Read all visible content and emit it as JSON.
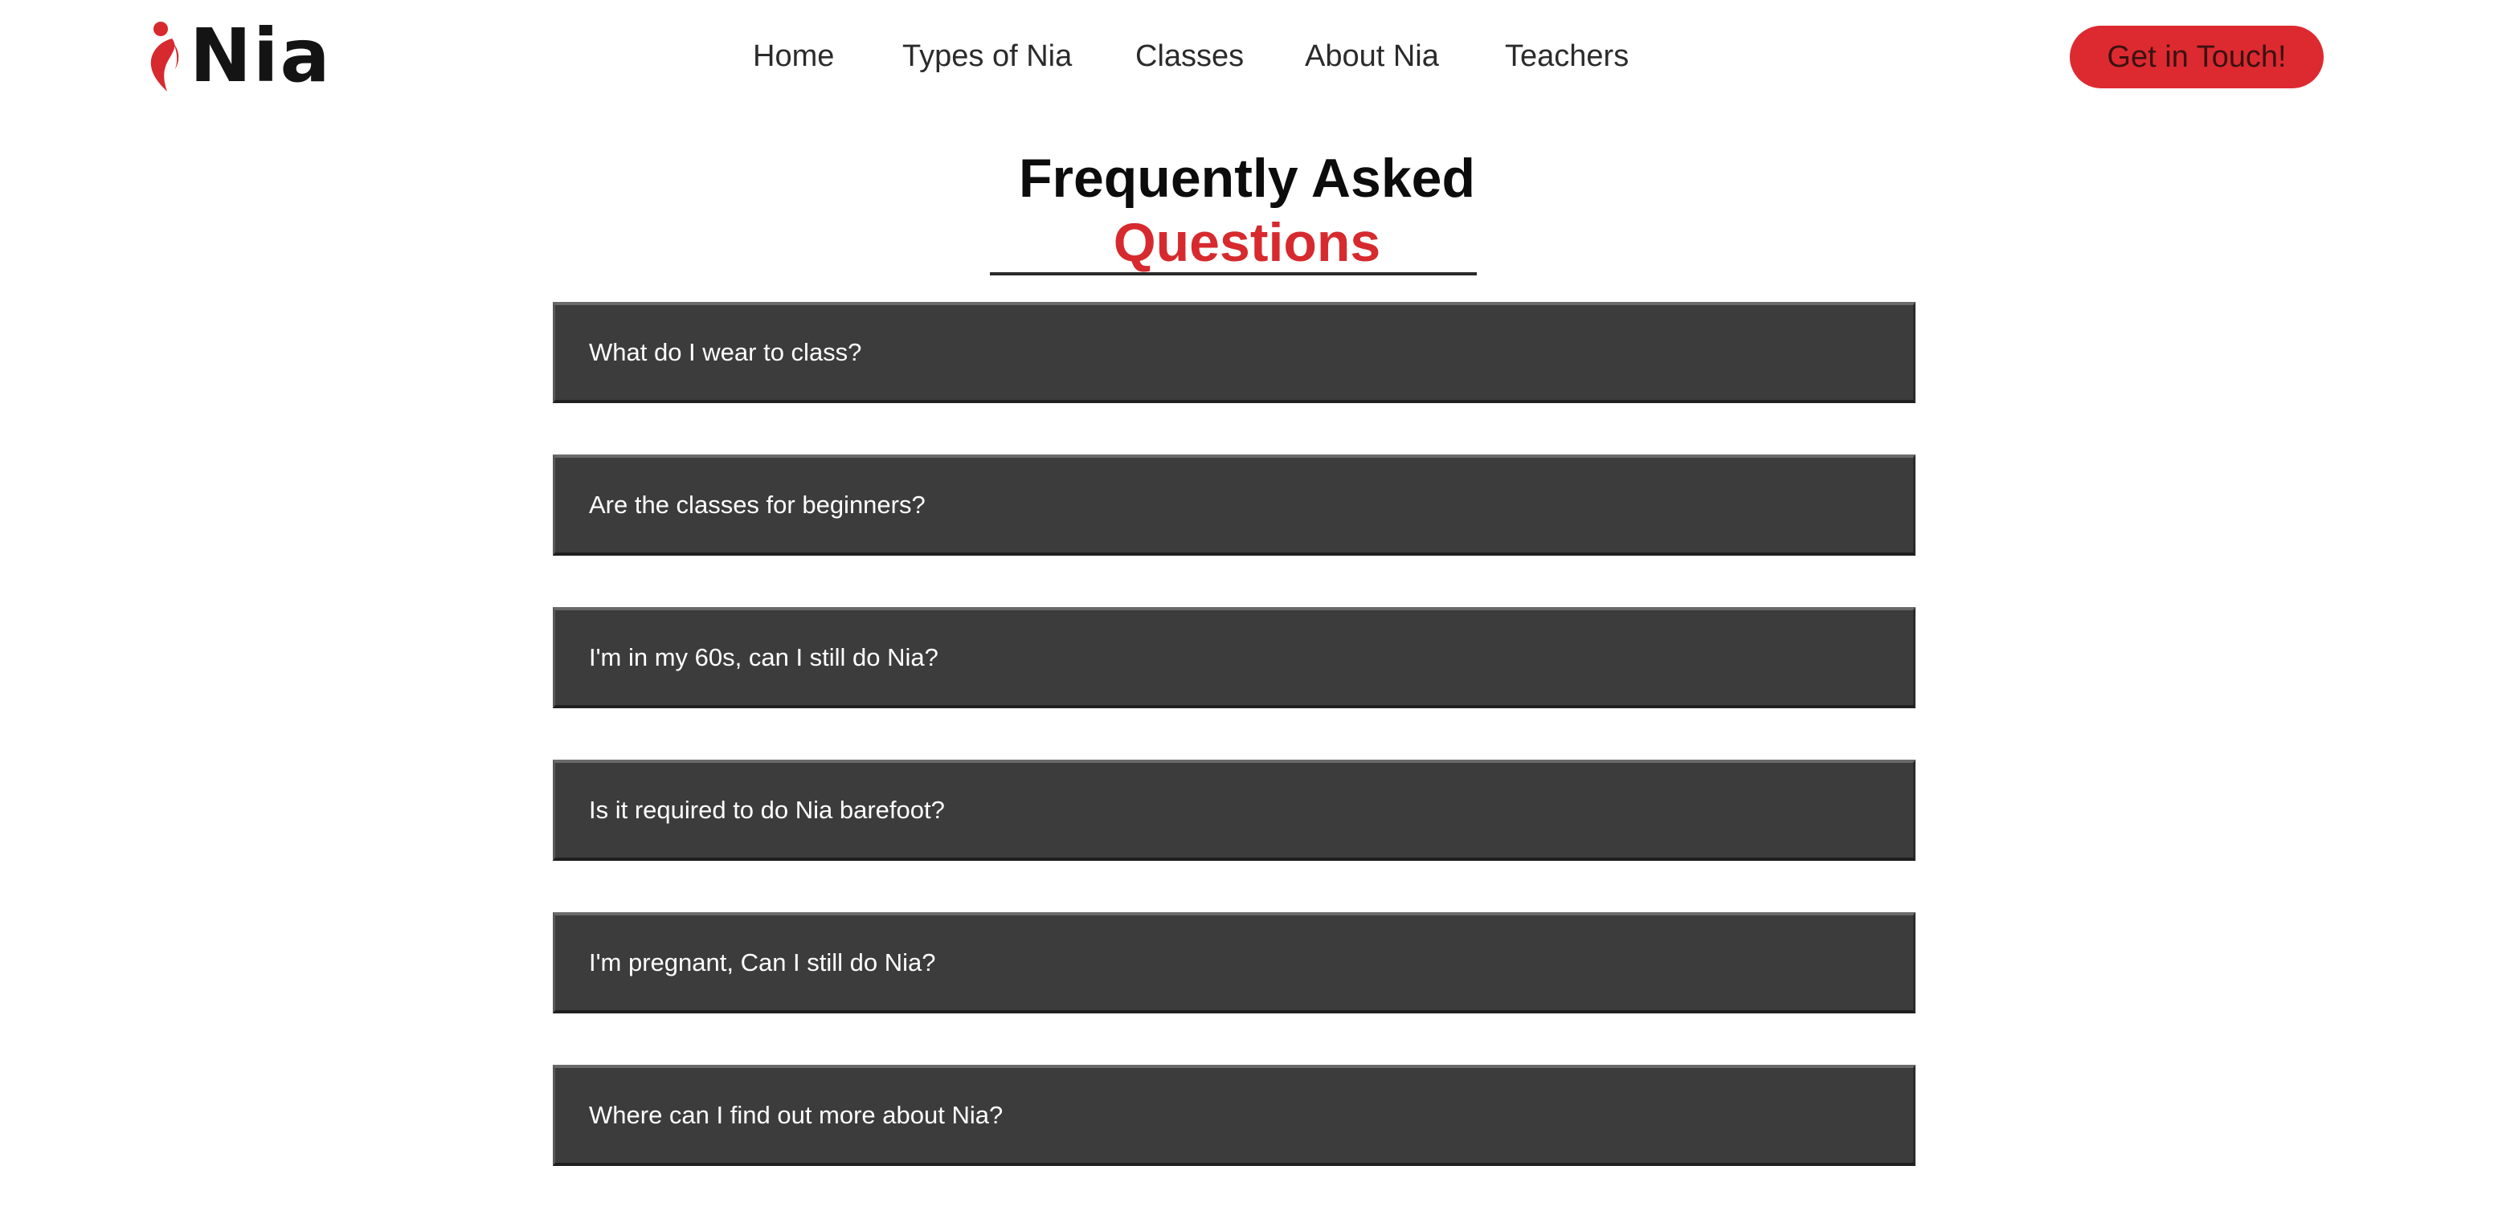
{
  "header": {
    "logo_text": "Nia",
    "nav": [
      "Home",
      "Types of Nia",
      "Classes",
      "About Nia",
      "Teachers"
    ],
    "cta_label": "Get in Touch!"
  },
  "faq": {
    "title": "Frequently Asked",
    "subtitle": "Questions",
    "questions": [
      "What do I wear to class?",
      "Are the classes for beginners?",
      "I'm in my 60s, can I still do Nia?",
      "Is it required to do Nia barefoot?",
      "I'm pregnant, Can I still do Nia?",
      "Where can I find out more about Nia?"
    ]
  },
  "colors": {
    "brand_red": "#dd2a30",
    "faq_item_bg": "#3c3c3c",
    "text_dark": "#2b2b2b"
  },
  "icons": {
    "logo_mark": "dancer-figure-icon"
  }
}
